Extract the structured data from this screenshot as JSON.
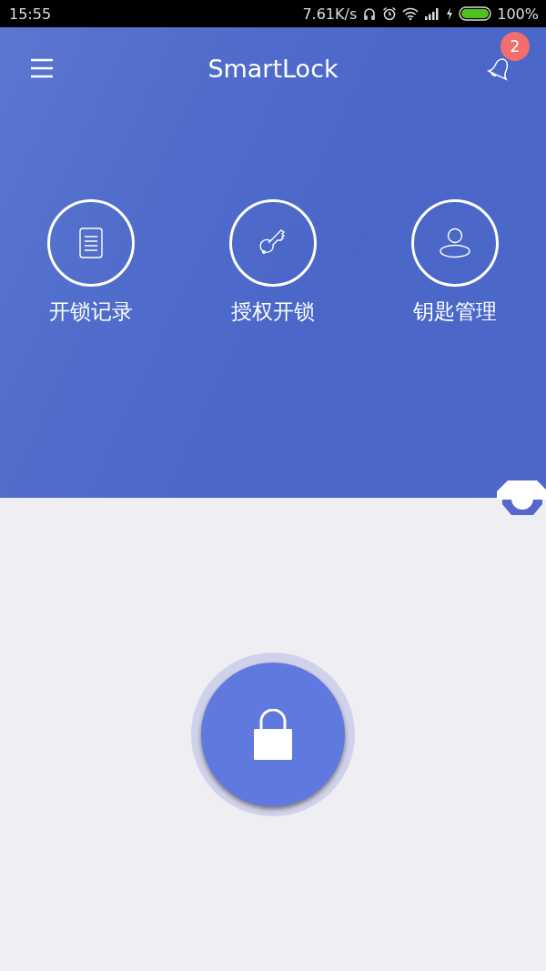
{
  "status_bar": {
    "time": "15:55",
    "speed": "7.61K/s",
    "battery": "100%"
  },
  "header": {
    "title": "SmartLock",
    "notification_count": "2"
  },
  "actions": [
    {
      "kind": "record",
      "label": "开锁记录"
    },
    {
      "kind": "key",
      "label": "授权开锁"
    },
    {
      "kind": "user",
      "label": "钥匙管理"
    }
  ]
}
